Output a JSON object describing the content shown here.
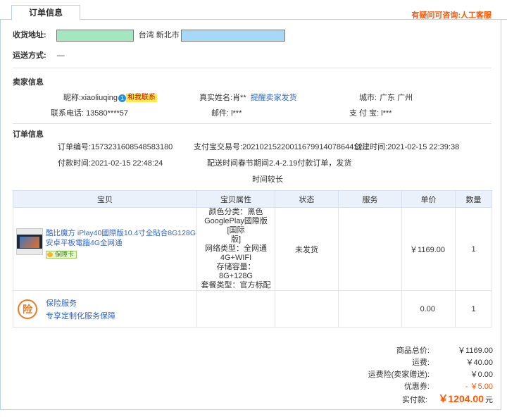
{
  "tab": {
    "label": "订单信息"
  },
  "help_text": "有疑问可咨询:人工客服",
  "shipping": {
    "address_label": "收货地址:",
    "address_region": "台湾 新北市",
    "method_label": "运送方式:",
    "method_value": "—"
  },
  "seller": {
    "heading": "卖家信息",
    "nickname_label": "昵称:",
    "nickname": "xiaoliuqing",
    "chat_badge": "1",
    "chat_label": "和我联系",
    "realname_label": "真实姓名:",
    "realname": "肖**",
    "remind_link": "提醒卖家发货",
    "city_label": "城市:",
    "city": "广东 广州",
    "phone_label": "联系电话:",
    "phone": "13580****57",
    "email_label": "邮件:",
    "email": "l***",
    "alipay_label": "支 付 宝:",
    "alipay": "l***"
  },
  "order": {
    "heading": "订单信息",
    "order_no_label": "订单编号:",
    "order_no": "1573231608548583180",
    "alipay_trade_label": "支付宝交易号:",
    "alipay_trade": "2021021522001167991407864412",
    "created_label": "创建时间:",
    "created": "2021-02-15 22:39:38",
    "paid_label": "付款时间:",
    "paid": "2021-02-15 22:48:24",
    "delivery_note_1": "配送时间春节期间2.4-2.19付款订单，发货",
    "delivery_note_2": "时间较长"
  },
  "table": {
    "headers": [
      "宝贝",
      "宝贝属性",
      "状态",
      "服务",
      "单价",
      "数量"
    ],
    "product": {
      "title": "酷比魔方 iPlay40國際版10.4寸全貼合8G128G安卓平板電腦4G全网通",
      "guarantee": "保障卡",
      "attr_lines": [
        "颜色分类：黑色",
        "GooglePlay國際版[国际",
        "版]",
        "网络类型：全网通",
        "4G+WIFI",
        "存储容量：8G+128G",
        "套餐类型：官方标配"
      ],
      "status": "未发货",
      "price": "￥1169.00",
      "qty": "1"
    },
    "insurance": {
      "icon": "险",
      "title": "保险服务",
      "subtitle": "专享定制化服务保障",
      "price": "0.00",
      "qty": "1"
    }
  },
  "summary": {
    "goods_label": "商品总价:",
    "goods": "￥1169.00",
    "shipping_label": "运费:",
    "shipping": "￥40.00",
    "ship_ins_label": "运费险(卖家赠送):",
    "ship_ins": "￥0.00",
    "coupon_label": "优惠券:",
    "coupon": "- ￥5.00",
    "paid_label": "实付款:",
    "paid": "￥1204.00",
    "currency": "元"
  },
  "colors": {
    "accent": "#ff5400",
    "link": "#3366cc",
    "border": "#b7d1e9"
  }
}
